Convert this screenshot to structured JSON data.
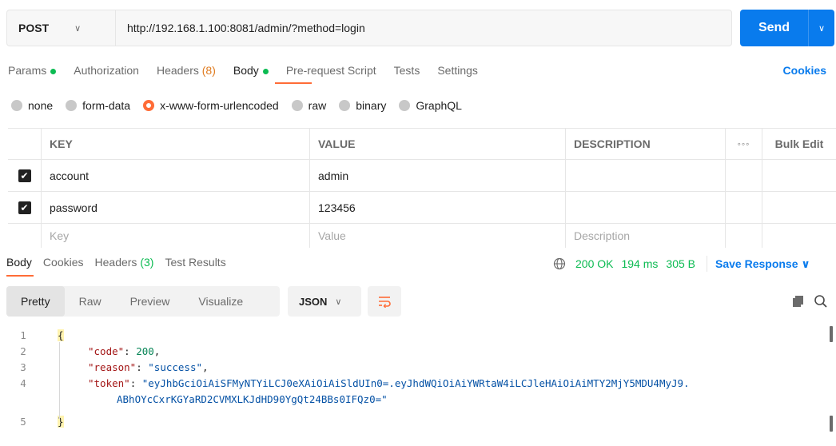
{
  "request": {
    "method": "POST",
    "url": "http://192.168.1.100:8081/admin/?method=login",
    "send_label": "Send"
  },
  "req_tabs": {
    "params": "Params",
    "authorization": "Authorization",
    "headers": "Headers",
    "headers_count": "(8)",
    "body": "Body",
    "prerequest": "Pre-request Script",
    "tests": "Tests",
    "settings": "Settings",
    "cookies": "Cookies"
  },
  "body_types": {
    "none": "none",
    "form_data": "form-data",
    "urlencoded": "x-www-form-urlencoded",
    "raw": "raw",
    "binary": "binary",
    "graphql": "GraphQL",
    "selected": "x-www-form-urlencoded"
  },
  "table": {
    "headers": {
      "key": "KEY",
      "value": "VALUE",
      "description": "DESCRIPTION",
      "bulk_edit": "Bulk Edit"
    },
    "rows": [
      {
        "checked": true,
        "key": "account",
        "value": "admin",
        "description": ""
      },
      {
        "checked": true,
        "key": "password",
        "value": "123456",
        "description": ""
      }
    ],
    "placeholders": {
      "key": "Key",
      "value": "Value",
      "description": "Description"
    }
  },
  "res_tabs": {
    "body": "Body",
    "cookies": "Cookies",
    "headers": "Headers",
    "headers_count": "(3)",
    "test_results": "Test Results"
  },
  "res_status": {
    "status": "200 OK",
    "time": "194 ms",
    "size": "305 B",
    "save_response": "Save Response"
  },
  "view": {
    "pretty": "Pretty",
    "raw": "Raw",
    "preview": "Preview",
    "visualize": "Visualize",
    "format": "JSON"
  },
  "code": {
    "line_numbers": [
      "1",
      "2",
      "3",
      "4",
      "5"
    ],
    "open_brace": "{",
    "close_brace": "}",
    "code_key": "\"code\"",
    "code_val": "200",
    "reason_key": "\"reason\"",
    "reason_val": "\"success\"",
    "token_key": "\"token\"",
    "token_val_1": "\"eyJhbGciOiAiSFMyNTYiLCJ0eXAiOiAiSldUIn0=.eyJhdWQiOiAiYWRtaW4iLCJleHAiOiAiMTY2MjY5MDU4MyJ9.",
    "token_val_2": "ABhOYcCxrKGYaRD2CVMXLKJdHD90YgQt24BBs0IFQz0=\""
  }
}
